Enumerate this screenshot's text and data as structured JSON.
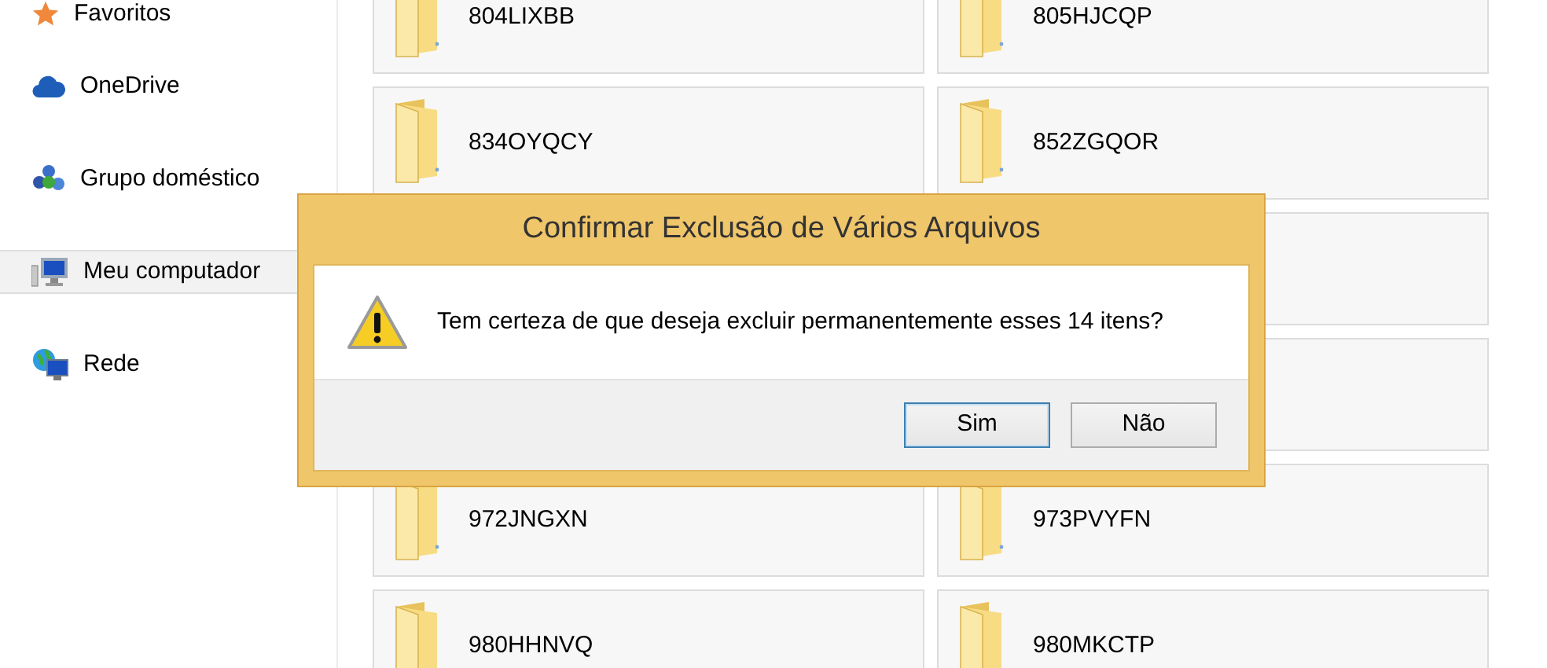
{
  "sidebar": {
    "items": [
      {
        "label": "Favoritos",
        "kind": "favorites",
        "selected": false
      },
      {
        "label": "OneDrive",
        "kind": "cloud",
        "selected": false
      },
      {
        "label": "Grupo doméstico",
        "kind": "homegroup",
        "selected": false
      },
      {
        "label": "Meu computador",
        "kind": "computer",
        "selected": true
      },
      {
        "label": "Rede",
        "kind": "network",
        "selected": false
      }
    ]
  },
  "folders": [
    {
      "kind": "folder",
      "name": "804LIXBB"
    },
    {
      "kind": "folder",
      "name": "805HJCQP"
    },
    {
      "kind": "folder",
      "name": "834OYQCY"
    },
    {
      "kind": "folder",
      "name": "852ZGQOR"
    },
    {
      "kind": "covered"
    },
    {
      "kind": "covered"
    },
    {
      "kind": "folder",
      "name": "972JNGXN"
    },
    {
      "kind": "folder",
      "name": "973PVYFN"
    },
    {
      "kind": "folder",
      "name": "980HHNVQ"
    },
    {
      "kind": "folder",
      "name": "980MKCTP"
    }
  ],
  "dialog": {
    "title": "Confirmar Exclusão de Vários Arquivos",
    "message": "Tem certeza de que deseja excluir permanentemente esses 14 itens?",
    "buttons": [
      {
        "label": "Sim",
        "default": true
      },
      {
        "label": "Não",
        "default": false
      }
    ]
  }
}
